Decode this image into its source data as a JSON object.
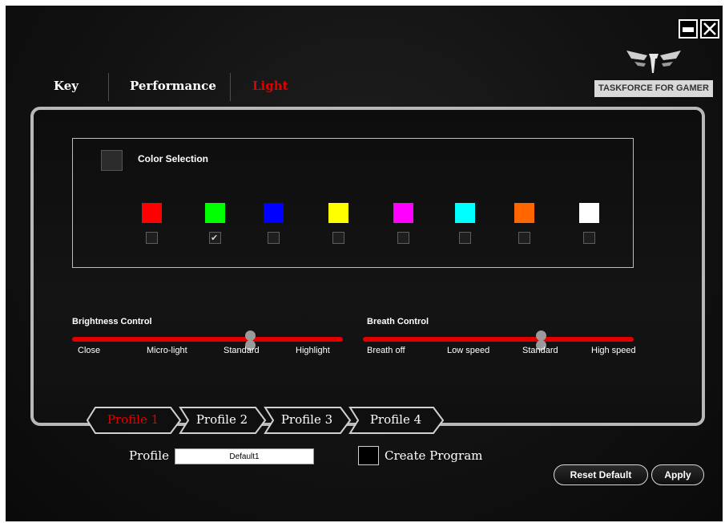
{
  "window": {
    "minimize_icon": "minimize-icon",
    "close_icon": "close-icon"
  },
  "brand": {
    "text": "TASKFORCE FOR GAMER"
  },
  "tabs": [
    {
      "label": "Key",
      "active": false
    },
    {
      "label": "Performance",
      "active": false
    },
    {
      "label": "Light",
      "active": true
    }
  ],
  "color_selection": {
    "label": "Color Selection",
    "current_color": "#2c2c2c",
    "swatches": [
      {
        "color": "#ff0000",
        "checked": false
      },
      {
        "color": "#00ff00",
        "checked": true
      },
      {
        "color": "#0000ff",
        "checked": false
      },
      {
        "color": "#ffff00",
        "checked": false
      },
      {
        "color": "#ff00ff",
        "checked": false
      },
      {
        "color": "#00ffff",
        "checked": false
      },
      {
        "color": "#ff6600",
        "checked": false
      },
      {
        "color": "#ffffff",
        "checked": false
      }
    ]
  },
  "brightness": {
    "title": "Brightness Control",
    "levels": [
      "Close",
      "Micro-light",
      "Standard",
      "Highlight"
    ],
    "selected": "Standard"
  },
  "breath": {
    "title": "Breath Control",
    "levels": [
      "Breath off",
      "Low speed",
      "Standard",
      "High speed"
    ],
    "selected": "Standard"
  },
  "profiles": [
    {
      "label": "Profile 1",
      "active": true
    },
    {
      "label": "Profile 2",
      "active": false
    },
    {
      "label": "Profile 3",
      "active": false
    },
    {
      "label": "Profile 4",
      "active": false
    }
  ],
  "profile_field": {
    "label": "Profile",
    "value": "Default1"
  },
  "create_program": {
    "label": "Create Program",
    "checked": false
  },
  "buttons": {
    "reset": "Reset Default",
    "apply": "Apply"
  },
  "accent_color": "#e00000"
}
